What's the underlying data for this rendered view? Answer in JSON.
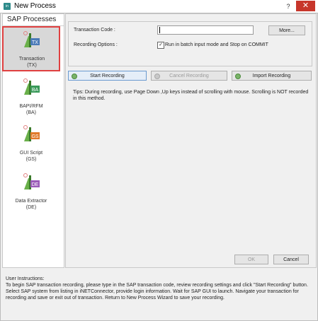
{
  "window": {
    "title": "New Process",
    "app_icon_text": "in",
    "help_label": "?",
    "close_label": "✕"
  },
  "sidebar": {
    "title": "SAP Processes",
    "items": [
      {
        "code": "TX",
        "label": "Transaction",
        "sub": "(TX)",
        "color": "#4a7ab8",
        "selected": true
      },
      {
        "code": "BA",
        "label": "BAPI/RFM",
        "sub": "(BA)",
        "color": "#3a9a5a"
      },
      {
        "code": "GS",
        "label": "GUI Script",
        "sub": "(GS)",
        "color": "#e07a2a"
      },
      {
        "code": "DE",
        "label": "Data Extractor",
        "sub": "(DE)",
        "color": "#9a5ab8"
      }
    ]
  },
  "form": {
    "transaction_code_label": "Transaction Code :",
    "transaction_code_value": "",
    "more_button": "More...",
    "recording_options_label": "Recording Options :",
    "batch_checkbox_label": "Run in batch input mode and Stop on COMMIT",
    "batch_checked": true
  },
  "buttons": {
    "start": "Start Recording",
    "cancel": "Cancel Recording",
    "import": "Import Recording",
    "ok": "OK",
    "cancel_dialog": "Cancel"
  },
  "tips": "Tips: During recording, use Page Down ,Up keys instead of scrolling with mouse. Scrolling is NOT recorded in this method.",
  "instructions": {
    "header": "User Instructions:",
    "text": "To begin SAP transaction recording, please type in the SAP transaction code, review recording settings and click \"Start Recording\" button. Select SAP system from listing in iNETConnector, provide login information. Wait for SAP GUI to launch. Navigate your transaction for recording and save or exit out of transaction. Return to New Process Wizard to save your recording."
  },
  "colors": {
    "selected_border": "#e04040",
    "close_button": "#c7362b"
  }
}
